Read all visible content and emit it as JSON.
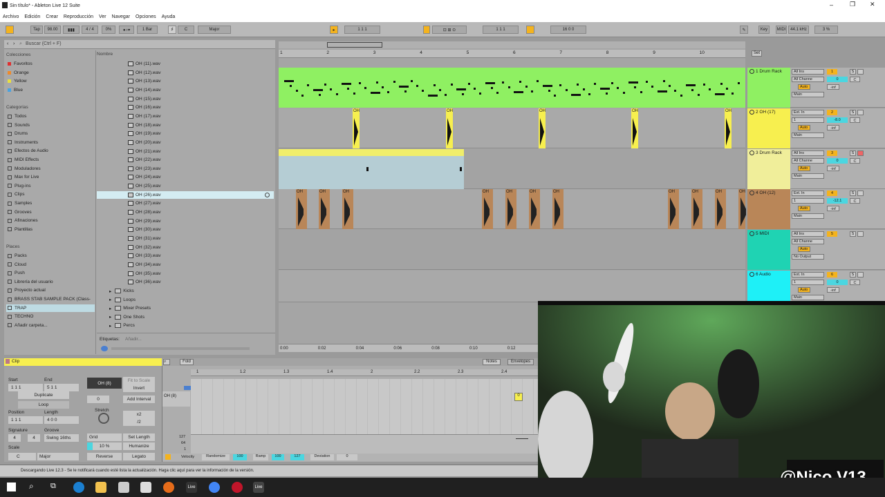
{
  "window": {
    "title": "Sin título* - Ableton Live 12 Suite"
  },
  "menu": [
    "Archivo",
    "Edición",
    "Crear",
    "Reproducción",
    "Ver",
    "Navegar",
    "Opciones",
    "Ayuda"
  ],
  "transport": {
    "tap": "Tap",
    "tempo": "98.00",
    "sig_num": "4",
    "sig_den": "4",
    "groove": "0%",
    "quant": "1 Bar",
    "key_root": "C",
    "key_scale": "Major",
    "position": "1   1   1",
    "loop_start": "1   1   1",
    "loop_len": "16   0   0",
    "key_label": "Key",
    "midi_label": "MIDI",
    "sample_rate": "44.1 kHz",
    "cpu": "3 %"
  },
  "browser": {
    "search_placeholder": "Buscar (Ctrl + F)",
    "name_header": "Nombre",
    "collections_title": "Colecciones",
    "collections": [
      {
        "label": "Favoritos",
        "color": "#e03030"
      },
      {
        "label": "Orange",
        "color": "#ef8a2a"
      },
      {
        "label": "Yellow",
        "color": "#e9e040"
      },
      {
        "label": "Blue",
        "color": "#4aa3e0"
      }
    ],
    "categories_title": "Categorías",
    "categories": [
      "Todos",
      "Sounds",
      "Drums",
      "Instruments",
      "Efectos de Audio",
      "MIDI Effects",
      "Moduladores",
      "Max for Live",
      "Plug-ins",
      "Clips",
      "Samples",
      "Grooves",
      "Afinaciones",
      "Plantillas"
    ],
    "places_title": "Places",
    "places": [
      "Packs",
      "Cloud",
      "Push",
      "Librería del usuario",
      "Proyecto actual",
      "BRASS STAB SAMPLE PACK (Class-",
      "TRAP",
      "TECHNO",
      "Añadir carpeta..."
    ],
    "files": [
      "OH (11).wav",
      "OH (12).wav",
      "OH (13).wav",
      "OH (14).wav",
      "OH (15).wav",
      "OH (16).wav",
      "OH (17).wav",
      "OH (18).wav",
      "OH (19).wav",
      "OH (20).wav",
      "OH (21).wav",
      "OH (22).wav",
      "OH (23).wav",
      "OH (24).wav",
      "OH (25).wav",
      "OH (26).wav",
      "OH (27).wav",
      "OH (28).wav",
      "OH (29).wav",
      "OH (30).wav",
      "OH (31).wav",
      "OH (32).wav",
      "OH (33).wav",
      "OH (34).wav",
      "OH (35).wav",
      "OH (36).wav"
    ],
    "folders": [
      "Kicks",
      "Loops",
      "Mixer Presets",
      "One Shots",
      "Percs"
    ],
    "selected_file": "OH (26).wav",
    "tags_label": "Etiquetas:",
    "tags_value": "Añadir..."
  },
  "arrangement": {
    "bars": [
      "1",
      "2",
      "3",
      "4",
      "5",
      "6",
      "7",
      "8",
      "9",
      "10"
    ],
    "times": [
      "0:00",
      "0:02",
      "0:04",
      "0:06",
      "0:08",
      "0:10",
      "0:12"
    ],
    "set_label": "Set",
    "tracks": [
      {
        "num": "1",
        "name": "1 Drum Rack",
        "color": "#8ff062",
        "input": "All Ins",
        "channel": "All Channe",
        "monitor": "Auto",
        "output": "Main",
        "in_val": "0",
        "pan": "C",
        "send": "-inf"
      },
      {
        "num": "2",
        "name": "2 OH (17)",
        "color": "#f7ef4f",
        "input": "Ext. In",
        "channel": "1",
        "monitor": "Auto",
        "output": "Main",
        "in_val": "-8.0",
        "pan": "C",
        "send": "-inf"
      },
      {
        "num": "3",
        "name": "3 Drum Rack",
        "color": "#f0ee9a",
        "input": "All Ins",
        "channel": "All Channe",
        "monitor": "Auto",
        "output": "Main",
        "in_val": "0",
        "pan": "C",
        "send": "-inf"
      },
      {
        "num": "4",
        "name": "4 OH (12)",
        "color": "#b98658",
        "input": "Ext. In",
        "channel": "1",
        "monitor": "Auto",
        "output": "Main",
        "in_val": "-12.1",
        "pan": "C",
        "send": "-inf"
      },
      {
        "num": "5",
        "name": "5 MIDI",
        "color": "#1fd3b3",
        "input": "All Ins",
        "channel": "All Channe",
        "monitor": "Auto",
        "output": "No Output",
        "in_val": "",
        "pan": "",
        "send": ""
      },
      {
        "num": "6",
        "name": "6 Audio",
        "color": "#1ef0f7",
        "input": "Ext. In",
        "channel": "1",
        "monitor": "Auto",
        "output": "Main",
        "in_val": "0",
        "pan": "C",
        "send": "-inf"
      }
    ],
    "clip_label": "OH"
  },
  "clipview": {
    "title": "Clip",
    "fold": "Fold",
    "notes_tab": "Notes",
    "env_tab": "Envelopes",
    "start_label": "Start",
    "end_label": "End",
    "set_label": "Set",
    "start_val": "1   1   1",
    "end_val": "5   1   1",
    "duplicate": "Duplicate",
    "loop": "Loop",
    "position_label": "Position",
    "length_label": "Length",
    "position_val": "1   1   1",
    "length_val": "4   0   0",
    "signature_label": "Signature",
    "groove_label": "Groove",
    "sig_num": "4",
    "sig_den": "4",
    "groove_val": "Swing 16ths",
    "scale_label": "Scale",
    "scale_root": "C",
    "scale_name": "Major",
    "clip_name": "OH (8)",
    "fit": "Fit to Scale",
    "invert": "Invert",
    "add_interval": "Add Interval",
    "interval_val": "0",
    "stretch": "Stretch",
    "x2": "x2",
    "div2": "/2",
    "grid": "Grid",
    "set_length": "Set Length",
    "humanize": "Humanize",
    "humanize_val": "10 %",
    "reverse": "Reverse",
    "legato": "Legato",
    "ruler": [
      "1",
      "1.2",
      "1.3",
      "1.4",
      "2",
      "2.2",
      "2.3",
      "2.4"
    ],
    "lane_label": "OH (8)",
    "vel_max": "127",
    "vel_mid": "64",
    "vel_min": "1",
    "velocity_label": "Velocity",
    "randomize": "Randomize",
    "rand_val": "100",
    "ramp": "Ramp",
    "ramp_a": "100",
    "ramp_b": "127",
    "deviation": "Deviation",
    "dev_val": "0",
    "note_label": "0"
  },
  "status": {
    "text": "Descargando Live 12.3 - Se le notificará cuando esté lista la actualización. Haga clic aquí para ver la información de la versión."
  },
  "overlay": {
    "handle": "@Nico.V13"
  }
}
